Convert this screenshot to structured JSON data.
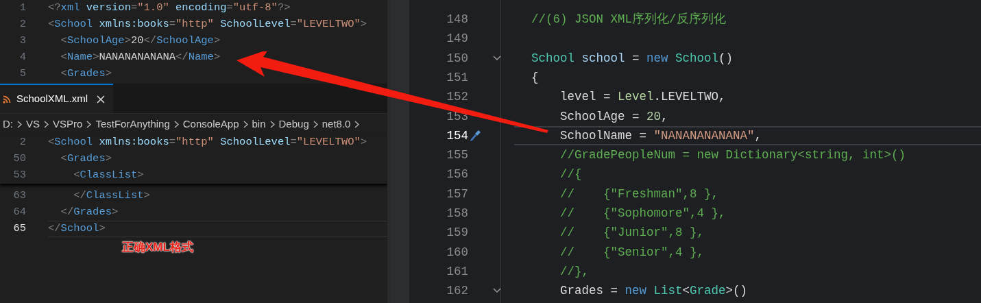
{
  "xml_editor": {
    "top_lines": [
      {
        "number": "1",
        "current": false,
        "segments": [
          {
            "kind": "punct",
            "text": "<?"
          },
          {
            "kind": "tag",
            "text": "xml"
          },
          {
            "kind": "attr",
            "text": " version"
          },
          {
            "kind": "punct",
            "text": "="
          },
          {
            "kind": "string",
            "text": "\"1.0\""
          },
          {
            "kind": "attr",
            "text": " encoding"
          },
          {
            "kind": "punct",
            "text": "="
          },
          {
            "kind": "string",
            "text": "\"utf-8\""
          },
          {
            "kind": "punct",
            "text": "?>"
          }
        ]
      },
      {
        "number": "2",
        "current": false,
        "segments": [
          {
            "kind": "punct",
            "text": "<"
          },
          {
            "kind": "tag",
            "text": "School"
          },
          {
            "kind": "attr",
            "text": " xmlns:books"
          },
          {
            "kind": "punct",
            "text": "="
          },
          {
            "kind": "string",
            "text": "\"http\""
          },
          {
            "kind": "attr",
            "text": " SchoolLevel"
          },
          {
            "kind": "punct",
            "text": "="
          },
          {
            "kind": "string",
            "text": "\"LEVELTWO\""
          },
          {
            "kind": "punct",
            "text": ">"
          }
        ]
      },
      {
        "number": "3",
        "current": false,
        "segments": [
          {
            "kind": "punct",
            "text": "  <"
          },
          {
            "kind": "tag",
            "text": "SchoolAge"
          },
          {
            "kind": "punct",
            "text": ">"
          },
          {
            "kind": "text",
            "text": "20"
          },
          {
            "kind": "punct",
            "text": "</"
          },
          {
            "kind": "tag",
            "text": "SchoolAge"
          },
          {
            "kind": "punct",
            "text": ">"
          }
        ]
      },
      {
        "number": "4",
        "current": false,
        "segments": [
          {
            "kind": "punct",
            "text": "  <"
          },
          {
            "kind": "tag",
            "text": "Name"
          },
          {
            "kind": "punct",
            "text": ">"
          },
          {
            "kind": "text",
            "text": "NANANANANANA"
          },
          {
            "kind": "punct",
            "text": "</"
          },
          {
            "kind": "tag",
            "text": "Name"
          },
          {
            "kind": "punct",
            "text": ">"
          }
        ]
      },
      {
        "number": "5",
        "current": false,
        "segments": [
          {
            "kind": "punct",
            "text": "  <"
          },
          {
            "kind": "tag",
            "text": "Grades"
          },
          {
            "kind": "punct",
            "text": ">"
          }
        ]
      }
    ],
    "tab": {
      "label": "SchoolXML.xml",
      "selected": true
    },
    "breadcrumb": [
      "D:",
      "VS",
      "VSPro",
      "TestForAnything",
      "ConsoleApp",
      "bin",
      "Debug",
      "net8.0"
    ],
    "sticky_lines": [
      {
        "number": "2",
        "current": false,
        "segments": [
          {
            "kind": "punct",
            "text": "<"
          },
          {
            "kind": "tag",
            "text": "School"
          },
          {
            "kind": "attr",
            "text": " xmlns:books"
          },
          {
            "kind": "punct",
            "text": "="
          },
          {
            "kind": "string",
            "text": "\"http\""
          },
          {
            "kind": "attr",
            "text": " SchoolLevel"
          },
          {
            "kind": "punct",
            "text": "="
          },
          {
            "kind": "string",
            "text": "\"LEVELTWO\""
          },
          {
            "kind": "punct",
            "text": ">"
          }
        ]
      },
      {
        "number": "50",
        "current": false,
        "segments": [
          {
            "kind": "punct",
            "text": "  <"
          },
          {
            "kind": "tag",
            "text": "Grades"
          },
          {
            "kind": "punct",
            "text": ">"
          }
        ]
      },
      {
        "number": "53",
        "current": false,
        "segments": [
          {
            "kind": "punct",
            "text": "    <"
          },
          {
            "kind": "tag",
            "text": "ClassList"
          },
          {
            "kind": "punct",
            "text": ">"
          }
        ]
      }
    ],
    "lines": [
      {
        "number": "63",
        "current": false,
        "segments": [
          {
            "kind": "punct",
            "text": "    </"
          },
          {
            "kind": "tag",
            "text": "ClassList"
          },
          {
            "kind": "punct",
            "text": ">"
          }
        ]
      },
      {
        "number": "64",
        "current": false,
        "segments": [
          {
            "kind": "punct",
            "text": "  </"
          },
          {
            "kind": "tag",
            "text": "Grades"
          },
          {
            "kind": "punct",
            "text": ">"
          }
        ]
      },
      {
        "number": "65",
        "current": true,
        "segments": [
          {
            "kind": "punct",
            "text": "</"
          },
          {
            "kind": "tag",
            "text": "School"
          },
          {
            "kind": "punct",
            "text": ">"
          }
        ]
      }
    ],
    "annotation": "正确XML格式"
  },
  "code_editor": {
    "lines": [
      {
        "number": "148",
        "current": false,
        "segments": [
          {
            "kind": "comment",
            "text": "//(6) JSON XML序列化/反序列化"
          }
        ]
      },
      {
        "number": "149",
        "current": false
      },
      {
        "number": "150",
        "current": false,
        "expanded": true,
        "segments": [
          {
            "kind": "type",
            "text": "School"
          },
          {
            "kind": "variable",
            "text": " school"
          },
          {
            "kind": "plain",
            "text": " = "
          },
          {
            "kind": "keyword",
            "text": "new"
          },
          {
            "kind": "type",
            "text": " School"
          },
          {
            "kind": "plain",
            "text": "()"
          }
        ]
      },
      {
        "number": "151",
        "current": false,
        "segments": [
          {
            "kind": "plain",
            "text": "{"
          }
        ]
      },
      {
        "number": "152",
        "current": false,
        "segments": [
          {
            "kind": "plain",
            "text": "    level = "
          },
          {
            "kind": "enum",
            "text": "Level"
          },
          {
            "kind": "plain",
            "text": ".LEVELTWO,"
          }
        ]
      },
      {
        "number": "153",
        "current": false,
        "segments": [
          {
            "kind": "plain",
            "text": "    SchoolAge = "
          },
          {
            "kind": "number",
            "text": "20"
          },
          {
            "kind": "plain",
            "text": ","
          }
        ]
      },
      {
        "number": "154",
        "current": true,
        "segments": [
          {
            "kind": "plain",
            "text": "    SchoolName = "
          },
          {
            "kind": "string",
            "text": "\"NANANANANANA\""
          },
          {
            "kind": "plain",
            "text": ","
          }
        ]
      },
      {
        "number": "155",
        "current": false,
        "segments": [
          {
            "kind": "comment",
            "text": "    //GradePeopleNum = new Dictionary<string, int>()"
          }
        ]
      },
      {
        "number": "156",
        "current": false,
        "segments": [
          {
            "kind": "comment",
            "text": "    //{"
          }
        ]
      },
      {
        "number": "157",
        "current": false,
        "segments": [
          {
            "kind": "comment",
            "text": "    //    {\"Freshman\",8 },"
          }
        ]
      },
      {
        "number": "158",
        "current": false,
        "segments": [
          {
            "kind": "comment",
            "text": "    //    {\"Sophomore\",4 },"
          }
        ]
      },
      {
        "number": "159",
        "current": false,
        "segments": [
          {
            "kind": "comment",
            "text": "    //    {\"Junior\",8 },"
          }
        ]
      },
      {
        "number": "160",
        "current": false,
        "segments": [
          {
            "kind": "comment",
            "text": "    //    {\"Senior\",4 },"
          }
        ]
      },
      {
        "number": "161",
        "current": false,
        "segments": [
          {
            "kind": "comment",
            "text": "    //},"
          }
        ]
      },
      {
        "number": "162",
        "current": false,
        "expanded": true,
        "segments": [
          {
            "kind": "plain",
            "text": "    Grades = "
          },
          {
            "kind": "keyword",
            "text": "new"
          },
          {
            "kind": "type",
            "text": " List"
          },
          {
            "kind": "plain",
            "text": "<"
          },
          {
            "kind": "type",
            "text": "Grade"
          },
          {
            "kind": "plain",
            "text": ">()"
          }
        ]
      }
    ]
  }
}
